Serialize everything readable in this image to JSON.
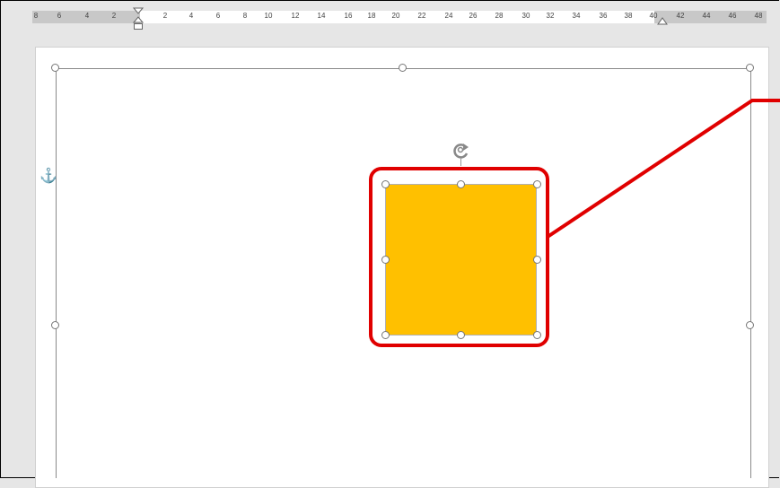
{
  "ruler": {
    "labels": [
      "8",
      "6",
      "4",
      "2",
      "2",
      "4",
      "6",
      "8",
      "10",
      "12",
      "14",
      "16",
      "18",
      "20",
      "22",
      "24",
      "26",
      "28",
      "30",
      "32",
      "34",
      "36",
      "38",
      "40",
      "42",
      "44",
      "46",
      "48"
    ]
  },
  "icons": {
    "anchor": "⚓",
    "rotate": "rotate-handle-icon"
  },
  "colors": {
    "shape_fill": "#ffc000",
    "callout": "#e00000",
    "anchor": "#2f8fd8"
  }
}
